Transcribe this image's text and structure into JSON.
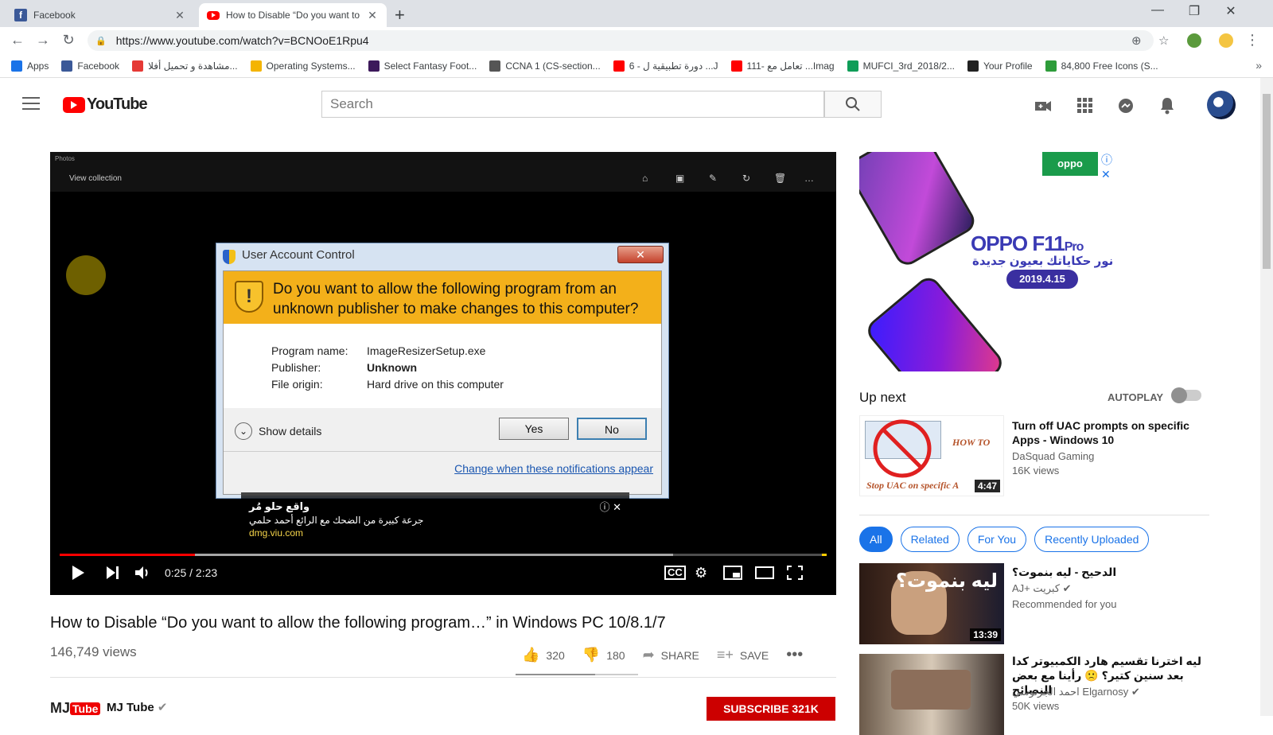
{
  "browser": {
    "tabs": [
      {
        "title": "Facebook",
        "active": false,
        "icon": "facebook-icon"
      },
      {
        "title": "How to Disable “Do you want to",
        "active": true,
        "icon": "youtube-icon"
      }
    ],
    "url": "https://www.youtube.com/watch?v=BCNOoE1Rpu4",
    "bookmarks": [
      {
        "label": "Apps",
        "icon": "apps-icon",
        "color": "#1a73e8"
      },
      {
        "label": "Facebook",
        "icon": "facebook-icon",
        "color": "#3b5998"
      },
      {
        "label": "مشاهدة و تحميل أفلا...",
        "icon": "site-icon",
        "color": "#e53935"
      },
      {
        "label": "Operating Systems...",
        "icon": "site-icon",
        "color": "#f4b400"
      },
      {
        "label": "Select Fantasy Foot...",
        "icon": "premier-league-icon",
        "color": "#3d195b"
      },
      {
        "label": "CCNA 1 (CS-section...",
        "icon": "cisco-icon",
        "color": "#555555"
      },
      {
        "label": "6 - دورة تطبيقية ل ...J",
        "icon": "youtube-icon",
        "color": "#ff0000"
      },
      {
        "label": "111- تعامل مع ...Imag",
        "icon": "youtube-icon",
        "color": "#ff0000"
      },
      {
        "label": "MUFCI_3rd_2018/2...",
        "icon": "drive-icon",
        "color": "#0f9d58"
      },
      {
        "label": "Your Profile",
        "icon": "github-icon",
        "color": "#222222"
      },
      {
        "label": "84,800 Free Icons (S...",
        "icon": "icons-site-icon",
        "color": "#2e9c3a"
      }
    ]
  },
  "youtube": {
    "search_placeholder": "Search",
    "logo_text": "YouTube"
  },
  "player": {
    "photos_app": "Photos",
    "view_collection": "View collection",
    "uac": {
      "title": "User Account Control",
      "question": "Do you want to allow the following program from an unknown publisher to make changes to this computer?",
      "program_label": "Program name:",
      "program_value": "ImageResizerSetup.exe",
      "publisher_label": "Publisher:",
      "publisher_value": "Unknown",
      "origin_label": "File origin:",
      "origin_value": "Hard drive on this computer",
      "show_details": "Show details",
      "yes": "Yes",
      "no": "No",
      "link": "Change when these notifications appear"
    },
    "ad": {
      "headline": "واقع حلو مُر",
      "body": "جرعة كبيرة من الضحك مع الرائع أحمد حلمي",
      "url": "dmg.viu.com"
    },
    "time_current": "0:25",
    "time_total": "2:23",
    "progress_played": 0.176,
    "progress_buffered": 0.8
  },
  "video": {
    "title": "How to Disable “Do you want to allow the following program…” in Windows PC 10/8.1/7",
    "views": "146,749 views",
    "likes": "320",
    "dislikes": "180",
    "share": "SHARE",
    "save": "SAVE",
    "channel_logo": "MJ",
    "channel_logo_tube": "Tube",
    "channel": "MJ Tube",
    "subscribe": "SUBSCRIBE 321K"
  },
  "sidebar": {
    "ad": {
      "brand": "oppo",
      "product": "OPPO F11",
      "product_suffix": "Pro",
      "tagline": "نور حكاياتك بعيون جديدة",
      "date": "2019.4.15"
    },
    "up_next": "Up next",
    "autoplay": "AUTOPLAY",
    "next_video": {
      "title": "Turn off UAC prompts on specific Apps - Windows 10",
      "channel": "DaSquad Gaming",
      "views": "16K views",
      "duration": "4:47",
      "thumb_caption": "Stop UAC on specific A",
      "thumb_howto": "HOW TO"
    },
    "chips": [
      "All",
      "Related",
      "For You",
      "Recently Uploaded"
    ],
    "videos": [
      {
        "title": "الدحيح - ليه بنموت؟",
        "channel": "AJ+ كبريت",
        "meta": "Recommended for you",
        "duration": "13:39",
        "thumb_text": "ليه بنموت؟"
      },
      {
        "title": "ليه اخترنا تقسيم هارد الكمبيوتر كدا بعد سنين كتير؟ 🙁 رأينا مع بعض النصائح",
        "channel": "احمد الجرنوسي Elgarnosy",
        "meta": "50K views",
        "duration": ""
      }
    ]
  }
}
